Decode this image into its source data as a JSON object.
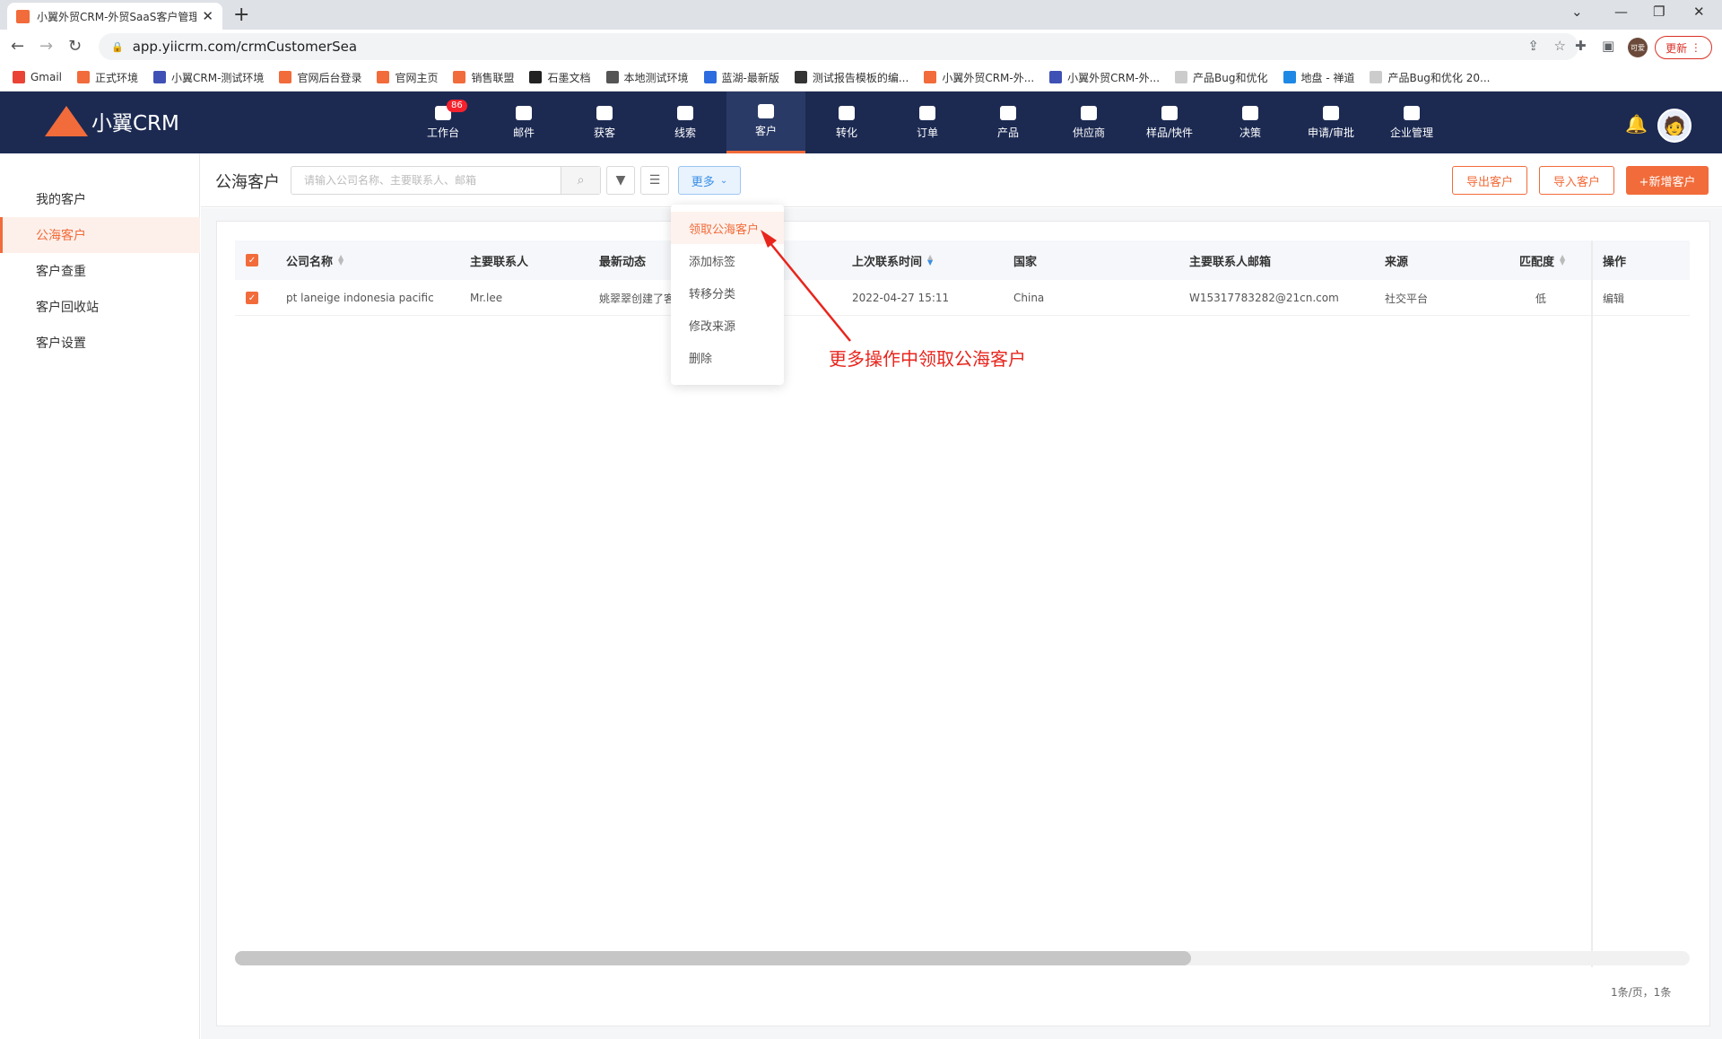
{
  "browser": {
    "tab_title": "小翼外贸CRM-外贸SaaS客户管理",
    "url": "app.yiicrm.com/crmCustomerSea",
    "update_label": "更新",
    "profile_label": "可爱",
    "bookmarks": [
      "Gmail",
      "正式环境",
      "小翼CRM-测试环境",
      "官网后台登录",
      "官网主页",
      "销售联盟",
      "石墨文档",
      "本地测试环境",
      "蓝湖-最新版",
      "测试报告模板的编...",
      "小翼外贸CRM-外...",
      "小翼外贸CRM-外...",
      "产品Bug和优化",
      "地盘 - 禅道",
      "产品Bug和优化 20..."
    ]
  },
  "app": {
    "logo_text": "小翼CRM",
    "nav": [
      {
        "label": "工作台",
        "badge": "86"
      },
      {
        "label": "邮件"
      },
      {
        "label": "获客"
      },
      {
        "label": "线索"
      },
      {
        "label": "客户"
      },
      {
        "label": "转化"
      },
      {
        "label": "订单"
      },
      {
        "label": "产品"
      },
      {
        "label": "供应商"
      },
      {
        "label": "样品/快件"
      },
      {
        "label": "决策"
      },
      {
        "label": "申请/审批"
      },
      {
        "label": "企业管理"
      }
    ],
    "active_nav": "客户",
    "accent_color": "#f26b3a",
    "nav_bg_color": "#1c2a52"
  },
  "sidebar": {
    "items": [
      "我的客户",
      "公海客户",
      "客户查重",
      "客户回收站",
      "客户设置"
    ],
    "active": "公海客户"
  },
  "toolbar": {
    "title": "公海客户",
    "search_placeholder": "请输入公司名称、主要联系人、邮箱",
    "more_label": "更多",
    "export_label": "导出客户",
    "import_label": "导入客户",
    "add_label": "+新增客户"
  },
  "table": {
    "columns": [
      "公司名称",
      "主要联系人",
      "最新动态",
      "上次联系时间",
      "国家",
      "主要联系人邮箱",
      "来源",
      "匹配度",
      "操作"
    ],
    "rows": [
      {
        "company": "pt laneige indonesia pacific",
        "contact": "Mr.lee",
        "activity": "姚翠翠创建了客",
        "last_contact": "2022-04-27 15:11",
        "country": "China",
        "email": "W15317783282@21cn.com",
        "source": "社交平台",
        "match": "低",
        "action": "编辑"
      }
    ],
    "pagination": "1条/页，1条"
  },
  "dropdown": {
    "items": [
      "领取公海客户",
      "添加标签",
      "转移分类",
      "修改来源",
      "删除"
    ],
    "highlighted": "领取公海客户"
  },
  "annotation": {
    "text": "更多操作中领取公海客户",
    "color": "#e8251d"
  }
}
